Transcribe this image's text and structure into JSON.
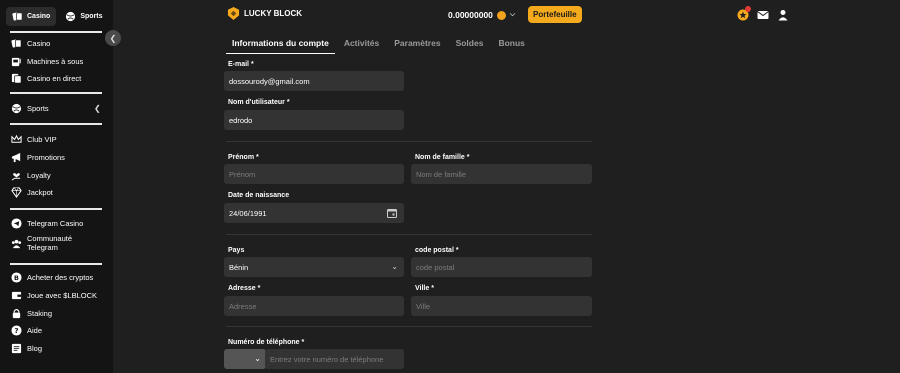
{
  "sidebar": {
    "top_toggle": {
      "casino": "Casino",
      "sports": "Sports"
    },
    "items": [
      {
        "label": "Casino"
      },
      {
        "label": "Machines à sous"
      },
      {
        "label": "Casino en direct"
      },
      {
        "label": "Sports"
      },
      {
        "label": "Club VIP"
      },
      {
        "label": "Promotions"
      },
      {
        "label": "Loyalty"
      },
      {
        "label": "Jackpot"
      },
      {
        "label": "Telegram Casino"
      },
      {
        "label": "Communauté\nTelegram"
      },
      {
        "label": "Acheter des cryptos"
      },
      {
        "label": "Joue avec $LBLOCK"
      },
      {
        "label": "Staking"
      },
      {
        "label": "Aide"
      },
      {
        "label": "Blog"
      }
    ]
  },
  "header": {
    "logo_text": "LUCKY BLOCK",
    "balance": "0.00000000",
    "wallet_button": "Portefeuille",
    "accent_color": "#f5a91d"
  },
  "tabs": [
    {
      "label": "Informations du compte"
    },
    {
      "label": "Activités"
    },
    {
      "label": "Paramètres"
    },
    {
      "label": "Soldes"
    },
    {
      "label": "Bonus"
    }
  ],
  "form": {
    "email": {
      "label": "E-mail *",
      "value": "dossourody@gmail.com"
    },
    "username": {
      "label": "Nom d'utilisateur *",
      "value": "edrodo"
    },
    "first_name": {
      "label": "Prénom *",
      "placeholder": "Prénom"
    },
    "last_name": {
      "label": "Nom de famille *",
      "placeholder": "Nom de famille"
    },
    "birthdate": {
      "label": "Date de naissance",
      "value": "24/06/1991"
    },
    "country": {
      "label": "Pays",
      "value": "Bénin"
    },
    "postal_code": {
      "label": "code postal *",
      "placeholder": "code postal"
    },
    "address": {
      "label": "Adresse *",
      "placeholder": "Adresse"
    },
    "city": {
      "label": "Ville *",
      "placeholder": "Ville"
    },
    "phone": {
      "label": "Numéro de téléphone *",
      "placeholder": "Entrez votre numéro de téléphone"
    }
  }
}
